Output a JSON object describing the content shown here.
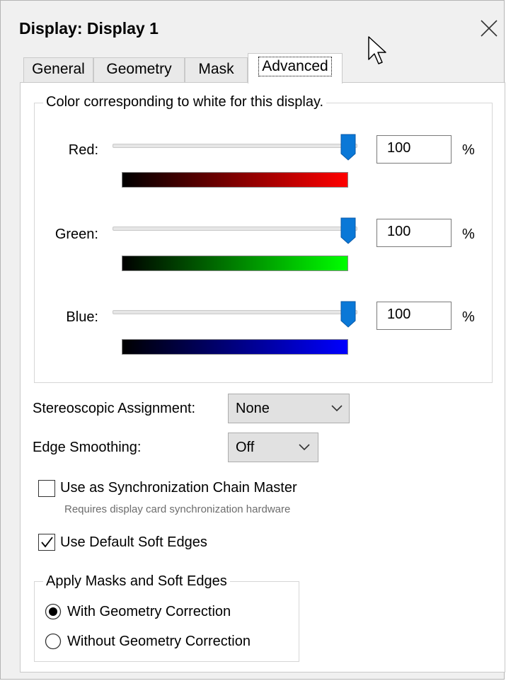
{
  "window": {
    "title": "Display: Display 1",
    "close_icon": "close-icon"
  },
  "tabs": [
    {
      "label": "General",
      "active": false
    },
    {
      "label": "Geometry",
      "active": false
    },
    {
      "label": "Mask",
      "active": false
    },
    {
      "label": "Advanced",
      "active": true
    }
  ],
  "white_color": {
    "group_title": "Color corresponding to white for this display.",
    "channels": [
      {
        "label": "Red:",
        "value": "100",
        "unit": "%",
        "slider_level": 1.0,
        "gradient_end": "#ff0000"
      },
      {
        "label": "Green:",
        "value": "100",
        "unit": "%",
        "slider_level": 1.0,
        "gradient_end": "#00ff00"
      },
      {
        "label": "Blue:",
        "value": "100",
        "unit": "%",
        "slider_level": 1.0,
        "gradient_end": "#0000ff"
      }
    ]
  },
  "stereo": {
    "label": "Stereoscopic Assignment:",
    "value": "None"
  },
  "edge_smoothing": {
    "label": "Edge Smoothing:",
    "value": "Off"
  },
  "sync_master": {
    "label": "Use as Synchronization Chain Master",
    "hint": "Requires display card synchronization hardware",
    "checked": false
  },
  "soft_edges": {
    "label": "Use Default Soft Edges",
    "checked": true
  },
  "masks_group": {
    "title": "Apply Masks and Soft Edges",
    "options": [
      {
        "label": "With Geometry Correction",
        "selected": true
      },
      {
        "label": "Without Geometry Correction",
        "selected": false
      }
    ]
  },
  "colors": {
    "accent": "#0a78d7",
    "panel": "#ffffff",
    "dialog": "#f0f0f0"
  }
}
